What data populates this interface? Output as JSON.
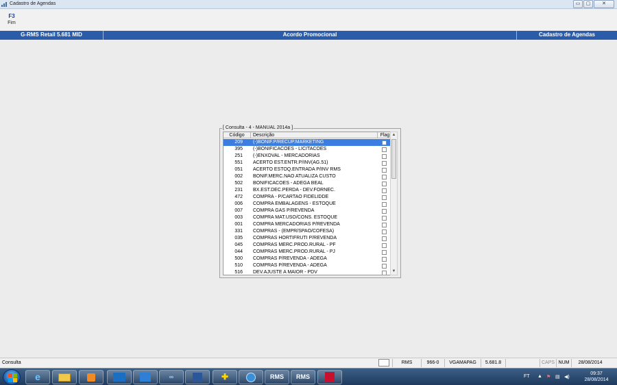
{
  "window": {
    "title": "Cadastro de Agendas",
    "min_label": "▭",
    "max_label": "▢",
    "close_label": "✕"
  },
  "toolbar": {
    "f3_key": "F3",
    "f3_label": "Fim"
  },
  "header": {
    "left": "G-RMS Retail 5.681 MID",
    "center": "Acordo Promocional",
    "right": "Cadastro de Agendas"
  },
  "consulta": {
    "legend": "[ Consulta - 4 - MANUAL 2014a ]",
    "columns": {
      "codigo": "Código",
      "descricao": "Descrição",
      "flag": "Flag"
    },
    "rows": [
      {
        "codigo": "209",
        "descricao": "(-)BONIF.P/RECUP.MARKETING"
      },
      {
        "codigo": "395",
        "descricao": "(-)BONIFICACOES - LICITACOES"
      },
      {
        "codigo": "251",
        "descricao": "(-)ENXOVAL - MERCADORIAS"
      },
      {
        "codigo": "551",
        "descricao": "ACERTO EST.ENTR.P/INV(AG.51)"
      },
      {
        "codigo": "051",
        "descricao": "ACERTO ESTOQ.ENTRADA P/INV RMS"
      },
      {
        "codigo": "002",
        "descricao": "BONIF.MERC.NAO ATUALIZA CUSTO"
      },
      {
        "codigo": "502",
        "descricao": "BONIFICACOES - ADEGA BEAL"
      },
      {
        "codigo": "231",
        "descricao": "BX.EST.DEC.PERDA - DEV.FORNEC."
      },
      {
        "codigo": "472",
        "descricao": "COMPRA - P/CARTAO FIDELIDDE"
      },
      {
        "codigo": "006",
        "descricao": "COMPRA EMBALAGENS - ESTOQUE"
      },
      {
        "codigo": "007",
        "descricao": "COMPRA GAS P/REVENDA"
      },
      {
        "codigo": "003",
        "descricao": "COMPRA MAT.USO/CONS. ESTOQUE"
      },
      {
        "codigo": "001",
        "descricao": "COMPRA MERCADORIAS P/REVENDA"
      },
      {
        "codigo": "331",
        "descricao": "COMPRAS - (EMPR/SPAO/COFESA)"
      },
      {
        "codigo": "035",
        "descricao": "COMPRAS HORTIFRUTI P/REVENDA"
      },
      {
        "codigo": "045",
        "descricao": "COMPRAS MERC.PROD.RURAL - PF"
      },
      {
        "codigo": "044",
        "descricao": "COMPRAS MERC.PROD.RURAL - PJ"
      },
      {
        "codigo": "500",
        "descricao": "COMPRAS P/REVENDA - ADEGA"
      },
      {
        "codigo": "510",
        "descricao": "COMPRAS P/REVENDA - ADEGA"
      },
      {
        "codigo": "516",
        "descricao": "DEV.AJUSTE A MAIOR - PDV"
      }
    ]
  },
  "statusbar": {
    "mode": "Consulta",
    "system": "RMS",
    "code": "966-0",
    "program": "VGAMAPAG",
    "version": "5.681.8",
    "caps": "CAPS",
    "num": "NUM",
    "date": "28/08/2014"
  },
  "taskbar": {
    "rms1": "RMS",
    "rms2": "RMS",
    "lang": "FT",
    "time": "09:37",
    "date": "28/08/2014"
  },
  "colors": {
    "header_blue": "#2a5caa",
    "selection_blue": "#3b7de0"
  }
}
